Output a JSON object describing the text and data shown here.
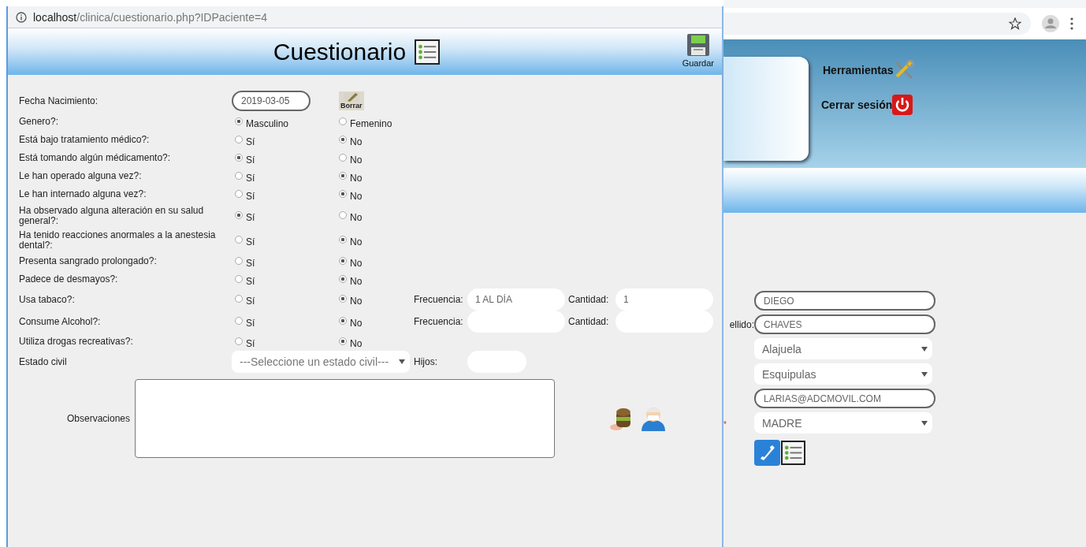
{
  "popup": {
    "url": {
      "host": "localhost",
      "path": "/clinica/cuestionario.php?IDPaciente=4"
    },
    "title": "Cuestionario",
    "save_label": "Guardar",
    "rows": [
      {
        "kind": "date",
        "label": "Fecha Nacimiento:",
        "value": "2019-03-05",
        "clear_label": "Borrar"
      },
      {
        "kind": "radio",
        "label": "Genero?:",
        "options": [
          {
            "label": "Masculino",
            "selected": true
          },
          {
            "label": "Femenino",
            "selected": false
          }
        ]
      },
      {
        "kind": "radio",
        "label": "Está bajo tratamiento médico?:",
        "options": [
          {
            "label": "Sí",
            "selected": false
          },
          {
            "label": "No",
            "selected": true
          }
        ]
      },
      {
        "kind": "radio",
        "label": "Está tomando algún médicamento?:",
        "options": [
          {
            "label": "Sí",
            "selected": true
          },
          {
            "label": "No",
            "selected": false
          }
        ]
      },
      {
        "kind": "radio",
        "label": "Le han operado alguna vez?:",
        "options": [
          {
            "label": "Sí",
            "selected": false
          },
          {
            "label": "No",
            "selected": true
          }
        ]
      },
      {
        "kind": "radio",
        "label": "Le han internado alguna vez?:",
        "options": [
          {
            "label": "Sí",
            "selected": false
          },
          {
            "label": "No",
            "selected": true
          }
        ]
      },
      {
        "kind": "radio",
        "label": "Ha observado alguna alteración en su salud general?:",
        "options": [
          {
            "label": "Sí",
            "selected": true
          },
          {
            "label": "No",
            "selected": false
          }
        ]
      },
      {
        "kind": "radio",
        "label": "Ha tenido reacciones anormales a la anestesia dental?:",
        "options": [
          {
            "label": "Sí",
            "selected": false
          },
          {
            "label": "No",
            "selected": true
          }
        ]
      },
      {
        "kind": "radio",
        "label": "Presenta sangrado prolongado?:",
        "options": [
          {
            "label": "Sí",
            "selected": false
          },
          {
            "label": "No",
            "selected": true
          }
        ]
      },
      {
        "kind": "radio",
        "label": "Padece de desmayos?:",
        "options": [
          {
            "label": "Sí",
            "selected": false
          },
          {
            "label": "No",
            "selected": true
          }
        ]
      },
      {
        "kind": "radio",
        "label": "Usa tabaco?:",
        "options": [
          {
            "label": "Sí",
            "selected": false
          },
          {
            "label": "No",
            "selected": true
          }
        ],
        "extras": [
          {
            "label": "Frecuencia:",
            "value": "1 AL DÍA"
          },
          {
            "label": "Cantidad:",
            "value": "1"
          }
        ]
      },
      {
        "kind": "radio",
        "label": "Consume Alcohol?:",
        "options": [
          {
            "label": "Sí",
            "selected": false
          },
          {
            "label": "No",
            "selected": true
          }
        ],
        "extras": [
          {
            "label": "Frecuencia:"
          },
          {
            "label": "Cantidad:"
          }
        ]
      },
      {
        "kind": "radio",
        "label": "Utiliza drogas recreativas?:",
        "options": [
          {
            "label": "Sí",
            "selected": false
          },
          {
            "label": "No",
            "selected": true
          }
        ]
      },
      {
        "kind": "select",
        "label": "Estado civil",
        "placeholder": "---Seleccione un estado civil---",
        "extras": [
          {
            "label": "Hijos:"
          }
        ]
      },
      {
        "kind": "textarea",
        "label": "Observaciones"
      }
    ]
  },
  "page": {
    "tools": [
      {
        "kind": "tools",
        "label": "Herramientas"
      },
      {
        "kind": "logout",
        "label": "Cerrar sesión"
      }
    ],
    "fields": [
      {
        "kind": "input",
        "value": "DIEGO"
      },
      {
        "kind": "input",
        "label": "ellido:",
        "value": "CHAVES"
      },
      {
        "kind": "select",
        "value": "Alajuela"
      },
      {
        "kind": "select",
        "value": "Esquipulas"
      },
      {
        "kind": "input",
        "value": "LARIAS@ADCMOVIL.COM"
      },
      {
        "kind": "select",
        "value": "MADRE",
        "marker": "*"
      }
    ]
  }
}
